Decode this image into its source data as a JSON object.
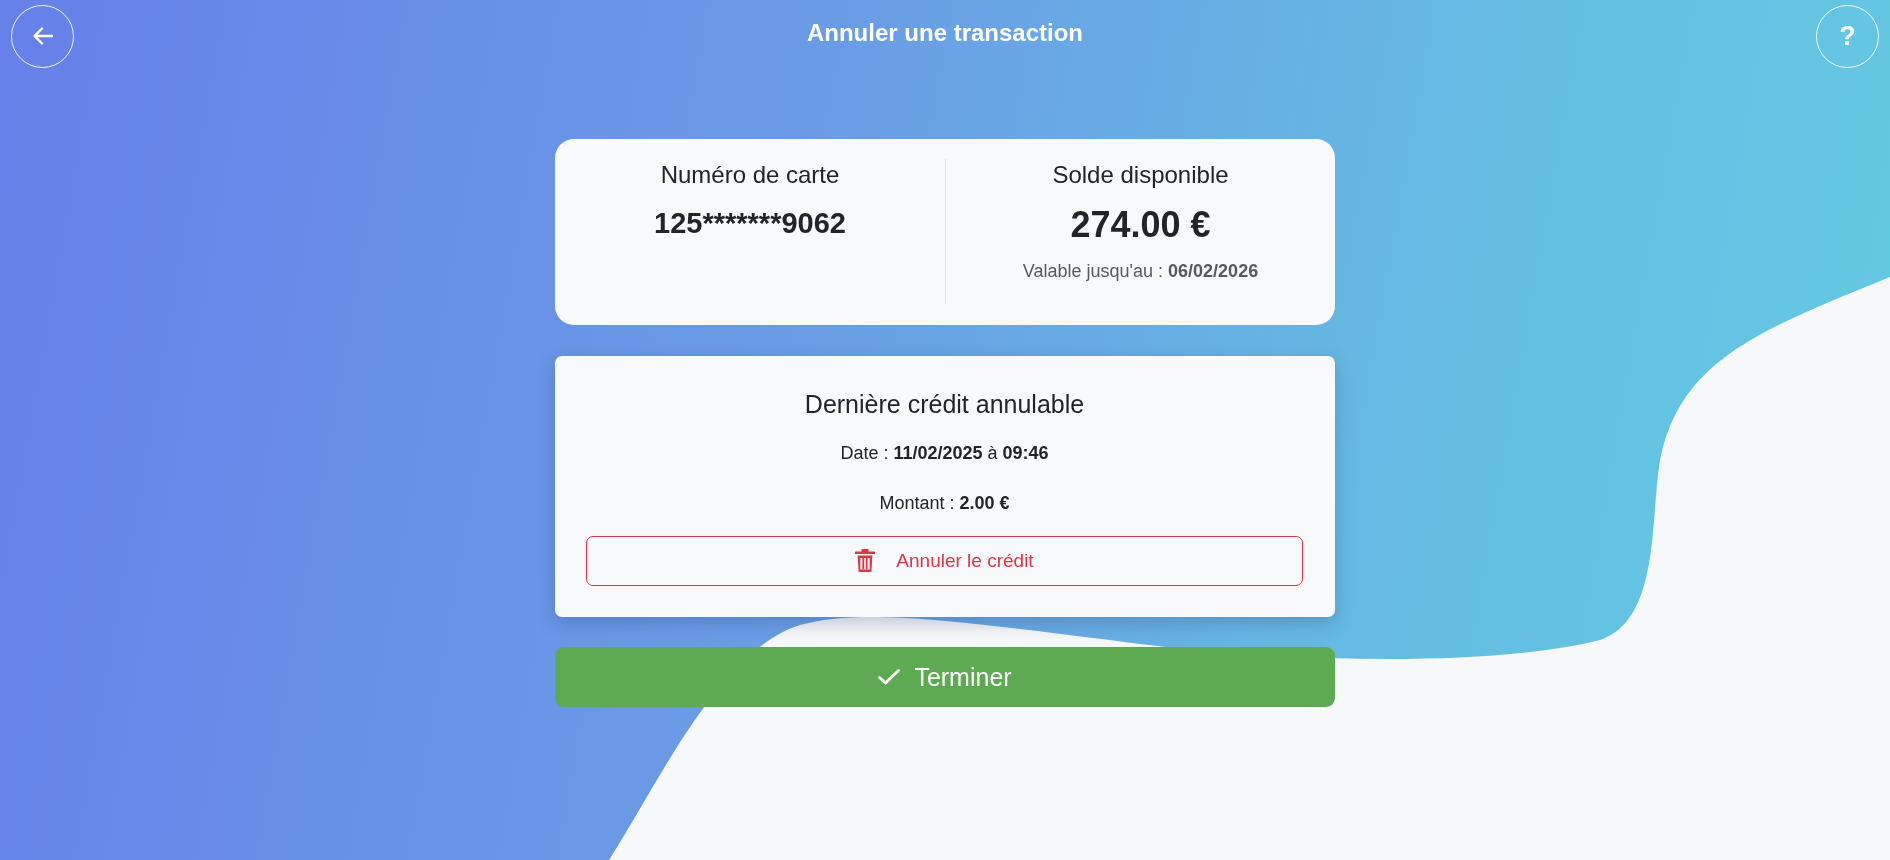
{
  "header": {
    "title": "Annuler une transaction",
    "help_button": "?"
  },
  "card_info": {
    "card_number_label": "Numéro de carte",
    "card_number": "125*******9062",
    "balance_label": "Solde disponible",
    "balance": "274.00 €",
    "validity": "Valable jusqu'au : **06/02/2026**"
  },
  "last_credit": {
    "title": "Dernière crédit annulable",
    "date": "Date : **11/02/2025** à **09:46**",
    "amount": "Montant : **2.00 €**",
    "cancel_button": "Annuler le crédit"
  },
  "finish_button": "Terminer"
}
